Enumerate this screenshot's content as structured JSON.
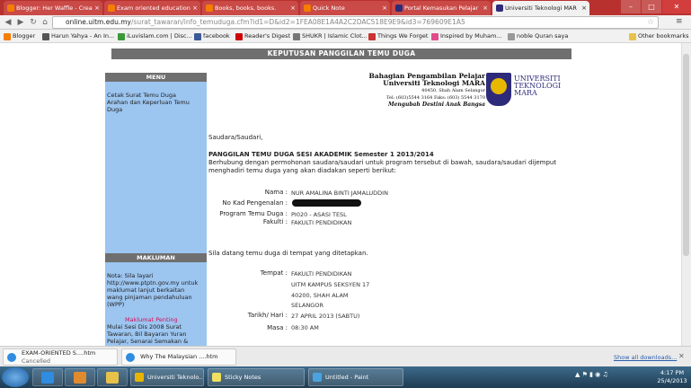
{
  "tabs": [
    {
      "label": "Blogger: Her Waffle - Crea",
      "color": "#f57d00"
    },
    {
      "label": "Exam oriented education",
      "color": "#f57d00"
    },
    {
      "label": "Books, books, books.",
      "color": "#f57d00"
    },
    {
      "label": "Quick Note",
      "color": "#f57d00"
    },
    {
      "label": "Portal Kemasukan Pelajar",
      "color": "#2e2a7a"
    },
    {
      "label": "Universiti Teknologi MAR",
      "color": "#2e2a7a"
    }
  ],
  "address": {
    "prefix": "online.uitm.edu.my",
    "rest": "/surat_tawaran/info_temuduga.cfm?id1=D&id2=1FEA08E1A4A2C2DAC518E9E9&id3=769609E1A5"
  },
  "bookmarks": [
    {
      "label": "Blogger",
      "color": "#f57d00"
    },
    {
      "label": "Harun Yahya - An In...",
      "color": "#555"
    },
    {
      "label": "iLuvislam.com | Disc...",
      "color": "#3a9a3a"
    },
    {
      "label": "facebook",
      "color": "#3b5998"
    },
    {
      "label": "Reader's Digest",
      "color": "#c00"
    },
    {
      "label": "SHUKR | Islamic Clot...",
      "color": "#777"
    },
    {
      "label": "Things We Forget",
      "color": "#c33"
    },
    {
      "label": "Inspired by Muham...",
      "color": "#e04c8a"
    },
    {
      "label": "noble Quran saya",
      "color": "#999"
    },
    {
      "label": "Other bookmarks",
      "color": "#e8c14a"
    }
  ],
  "page": {
    "banner": "KEPUTUSAN PANGGILAN TEMU DUGA",
    "menu_title": "MENU",
    "menu_items": [
      "Cetak Surat Temu Duga",
      "Arahan dan Keperluan Temu",
      "Duga"
    ],
    "makluman_title": "MAKLUMAN",
    "makluman_lines": [
      "Nota: Sila layari",
      "http://www.ptptn.gov.my untuk",
      "maklumat lanjut berkaitan",
      "wang pinjaman pendahuluan",
      "(WPP)"
    ],
    "makluman_important": "Maklumat Penting",
    "makluman_lines2": [
      "Mulai Sesi Dis 2008 Surat",
      "Tawaran, Bil Bayaran Yuran",
      "Pelajar, Senarai Semakan &"
    ],
    "header_lines": [
      "Bahagian Pengambilan Pelajar",
      "Universiti Teknologi MARA",
      "40450, Shah Alam Selangor",
      "Tel: (603)5544 3164 Faks: (603) 5544 3170",
      "Mengubah Destini Anak Bangsa"
    ],
    "logo_text": [
      "UNIVERSITI",
      "TEKNOLOGI",
      "MARA"
    ],
    "salutation": "Saudara/Saudari,",
    "heading": "PANGGILAN TEMU DUGA SESI AKADEMIK Semester 1 2013/2014",
    "intro1": "Berhubung dengan permohonan saudara/saudari untuk program tersebut di bawah, saudara/saudari dijemput",
    "intro2": "menghadiri temu duga yang akan diadakan seperti berikut:",
    "fields": [
      {
        "label": "Nama :",
        "value": "NUR AMALINA BINTI JAMALUDDIN"
      },
      {
        "label": "No Kad Pengenalan :",
        "value": ""
      },
      {
        "label": "Program Temu Duga :",
        "value": "PI020 - ASASI TESL"
      },
      {
        "label": "Fakulti :",
        "value": "FAKULTI PENDIDIKAN"
      }
    ],
    "invite": "Sila datang temu duga di tempat yang ditetapkan.",
    "venue_label": "Tempat :",
    "venue": [
      "FAKULTI PENDIDIKAN",
      "UITM KAMPUS SEKSYEN 17",
      "40200, SHAH ALAM",
      "SELANGOR"
    ],
    "date_label": "Tarikh/ Hari :",
    "date": "27 APRIL 2013 (SABTU)",
    "time_label": "Masa :",
    "time": "08:30 AM"
  },
  "downloads": [
    {
      "name": "EXAM-ORIENTED S....htm",
      "status": "Cancelled"
    },
    {
      "name": "Why The Malaysian ....htm",
      "status": ""
    }
  ],
  "show_all": "Show all downloads...",
  "taskbar": [
    {
      "label": "Universiti Teknolo...",
      "color": "#e8b400"
    },
    {
      "label": "Sticky Notes",
      "color": "#f0e060"
    },
    {
      "label": "Untitled - Paint",
      "color": "#4aa3e0"
    }
  ],
  "clock": {
    "time": "4:17 PM",
    "date": "25/4/2013"
  }
}
